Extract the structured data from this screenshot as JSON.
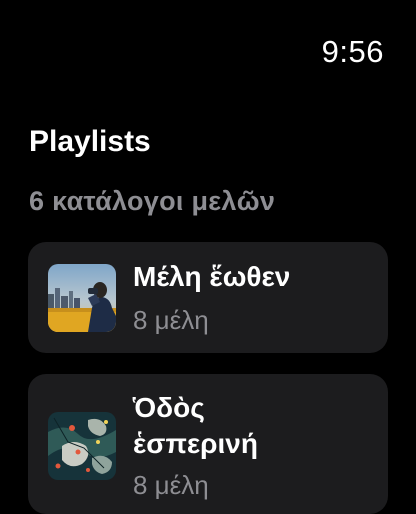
{
  "status": {
    "time": "9:56"
  },
  "header": {
    "title": "Playlists",
    "count_label": "6 κατάλογοι μελῶν"
  },
  "playlists": [
    {
      "title": "Μέλη ἕωθεν",
      "subtitle": "8 μέλη",
      "artwork": "city-sunrise-person-artwork"
    },
    {
      "title": "Ὁδὸς ἑσπερινή",
      "subtitle": "8 μέλη",
      "artwork": "abstract-map-artwork"
    }
  ],
  "colors": {
    "background": "#000000",
    "card": "#1c1c1e",
    "secondary_text": "#8e8e93"
  }
}
